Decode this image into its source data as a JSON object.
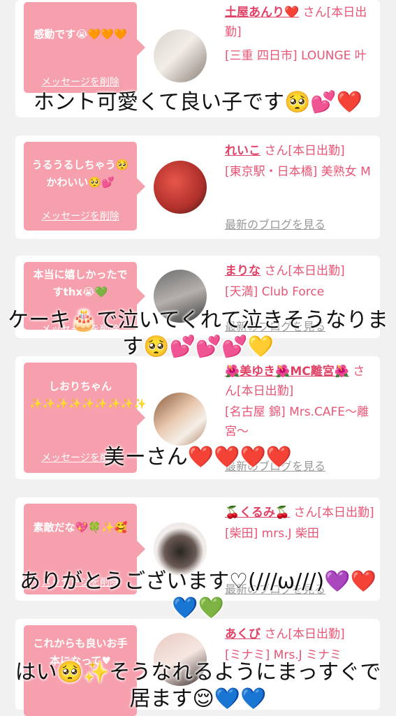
{
  "delete_label": "メッセージを削除",
  "blog_label": "最新のブログを見る",
  "cards": [
    {
      "message": "感動です😭🧡🧡🧡",
      "name": "土屋あんり❤️",
      "san": " さん[本日出勤]",
      "area": "[三重 四日市] LOUNGE 叶"
    },
    {
      "message": "うるうるしちゃう🥺かわいい🥺💕",
      "name": "れいこ",
      "san": " さん[本日出勤]",
      "area": "[東京駅・日本橋] 美熟女 M"
    },
    {
      "message": "本当に嬉しかったですthx😭💚",
      "name": "まりな",
      "san": " さん[本日出勤]",
      "area": "[天満] Club Force"
    },
    {
      "message": "しおりちゃん✨✨✨✨✨✨✨✨✨",
      "name": "🌺美ゆき🌺MC離宮🌺",
      "san": " さん[本日出勤]",
      "area": "[名古屋 錦] Mrs.CAFE〜離宮〜"
    },
    {
      "message": "素敵だな💖🍀✨🥰",
      "name": "🍒くるみ🍒",
      "san": " さん[本日出勤]",
      "area": "[柴田] mrs.J 柴田"
    },
    {
      "message": "これからも良いお手本になって♥",
      "name": "あくび",
      "san": " さん[本日出勤]",
      "area": "[ミナミ] Mrs.J ミナミ"
    }
  ],
  "overlays": [
    "ホント可愛くて良い子です🥺💕❤️",
    "ケーキ🎂で泣いてくれて泣きそうなります🥺💕💕💕💛",
    "美ーさん❤️❤️❤️❤️",
    "ありがとうございます♡(///ω///)💜❤️💙💚",
    "はい🥺✨そうなれるようにまっすぐで居ます😌💙💙"
  ],
  "colors": {
    "bubble": "#f7a0ad",
    "name": "#e04267",
    "text": "#e85574",
    "muted": "#999999",
    "background": "#f1f1f1"
  }
}
